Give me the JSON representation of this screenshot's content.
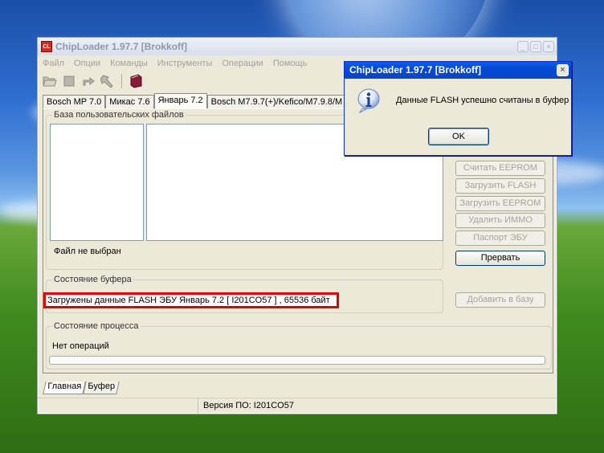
{
  "window": {
    "title": "ChipLoader 1.97.7 [Brokkoff]",
    "icon_label": "CL",
    "buttons": [
      "_",
      "□",
      "×"
    ]
  },
  "menu": [
    "Файл",
    "Опции",
    "Команды",
    "Инструменты",
    "Операции",
    "Помощь"
  ],
  "toolbar": [
    "open-folder-icon",
    "stop-icon",
    "reload-icon",
    "hammer-icon",
    "book-icon"
  ],
  "tabs": [
    "Bosch MP 7.0",
    "Микас 7.6",
    "Январь 7.2",
    "Bosch M7.9.7(+)/Kefico/M7.9.8/M"
  ],
  "active_tab": "Январь 7.2",
  "files_group": {
    "title": "База пользовательских файлов",
    "selected_file": "Файл не выбран"
  },
  "side_buttons": {
    "read_eeprom": "Считать EEPROM",
    "load_flash": "Загрузить FLASH",
    "load_eeprom": "Загрузить EEPROM",
    "delete_immo": "Удалить ИММО",
    "ecu_passport": "Паспорт ЭБУ",
    "abort": "Прервать",
    "add_to_db": "Добавить в базу"
  },
  "buffer_group": {
    "title": "Состояние буфера",
    "status": "Загружены данные FLASH ЭБУ Январь 7.2 [ I201CO57 ] , 65536 байт"
  },
  "process_group": {
    "title": "Состояние процесса",
    "status": "Нет операций",
    "progress": 0
  },
  "bottom_tabs": [
    "Главная",
    "Буфер"
  ],
  "statusbar": {
    "version": "Версия ПО: I201CO57"
  },
  "dialog": {
    "title": "ChipLoader 1.97.7 [Brokkoff]",
    "close": "×",
    "message": "Данные FLASH успешно считаны в буфер",
    "ok": "OK",
    "icon": "info-icon"
  },
  "colors": {
    "highlight_border": "#e10000",
    "dialog_titlebar": "#0548d4"
  }
}
